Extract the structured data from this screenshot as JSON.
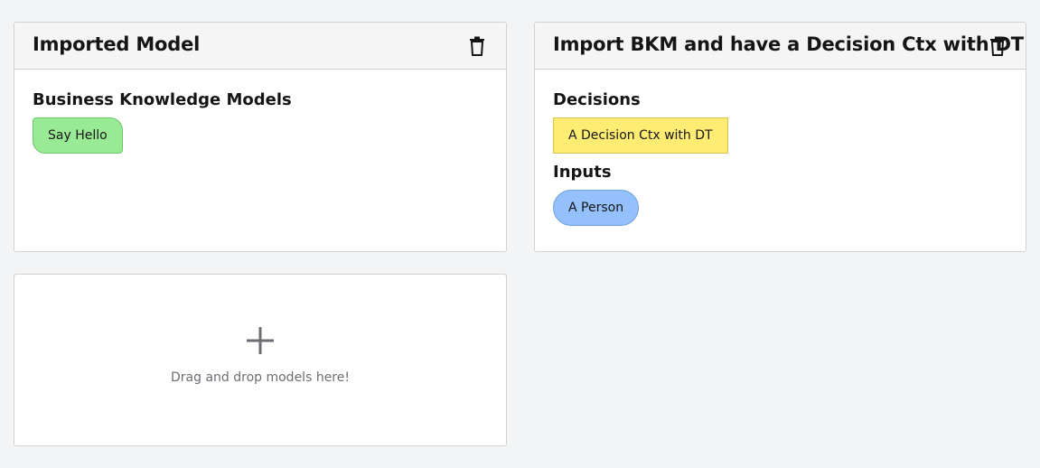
{
  "cards": [
    {
      "title": "Imported Model",
      "sections": [
        {
          "title": "Business Knowledge Models",
          "items": [
            {
              "label": "Say Hello",
              "kind": "bkm",
              "color": "#99ea94"
            }
          ]
        }
      ]
    },
    {
      "title": "Import BKM and have a Decision Ctx with DT",
      "sections": [
        {
          "title": "Decisions",
          "items": [
            {
              "label": "A Decision Ctx with DT",
              "kind": "decision",
              "color": "#ffec73"
            }
          ]
        },
        {
          "title": "Inputs",
          "items": [
            {
              "label": "A Person",
              "kind": "input",
              "color": "#94c1fc"
            }
          ]
        }
      ]
    }
  ],
  "dropzone": {
    "icon": "plus-icon",
    "text": "Drag and drop models here!"
  },
  "icons": {
    "delete": "trash-icon"
  }
}
